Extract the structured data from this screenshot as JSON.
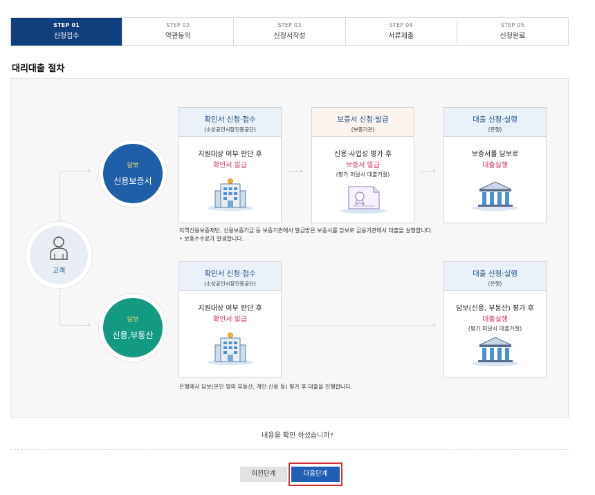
{
  "steps": [
    {
      "num": "STEP 01",
      "label": "신청접수"
    },
    {
      "num": "STEP 02",
      "label": "약관동의"
    },
    {
      "num": "STEP 03",
      "label": "신청서작성"
    },
    {
      "num": "STEP 04",
      "label": "서류제출"
    },
    {
      "num": "STEP 05",
      "label": "신청완료"
    }
  ],
  "active_step": 1,
  "section_title": "대리대출 절차",
  "customer": {
    "label": "고객"
  },
  "route1": {
    "circle_tag": "담보",
    "circle_name": "신용보증서",
    "card1": {
      "title": "확인서 신청·접수",
      "sub": "(소상공인시장진흥공단)",
      "line1": "지원대상 여부 판단 후",
      "line2": "확인서 발급"
    },
    "card2": {
      "title": "보증서 신청·발급",
      "sub": "(보증기관)",
      "line1": "신용·사업성 평가 후",
      "line2": "보증서 발급",
      "line3": "(평가 미달시 대출거절)"
    },
    "card3": {
      "title": "대출 신청·실행",
      "sub": "(은행)",
      "line1": "보증서를 담보로",
      "line2": "대출실행"
    },
    "note1": "지역신용보증재단, 신용보증기금 등 보증기관에서 발급받은 보증서를 담보로 금융기관에서 대출을 실행합니다.",
    "note2": "• 보증수수료가 발생합니다."
  },
  "route2": {
    "circle_tag": "담보",
    "circle_name": "신용,부동산",
    "card1": {
      "title": "확인서 신청·접수",
      "sub": "(소상공인시장진흥공단)",
      "line1": "지원대상 여부 판단 후",
      "line2": "확인서 발급"
    },
    "card3": {
      "title": "대출 신청·실행",
      "sub": "(은행)",
      "line1": "담보(신용, 부동산) 평가 후",
      "line2": "대출실행",
      "line3": "(평가 미달시 대출거절)"
    },
    "note": "은행에서 담보(본인 명의 부동산, 개인 신용 등) 평가 후 대출을 진행합니다."
  },
  "confirm_text": "내용을 확인 하셨습니까?",
  "buttons": {
    "prev": "이전단계",
    "next": "다음단계"
  },
  "colors": {
    "active_step": "#0e3e7c",
    "circle_blue": "#1f5fa8",
    "circle_green": "#159a82",
    "highlight": "#e1386b",
    "next_button": "#1f5fb4"
  }
}
